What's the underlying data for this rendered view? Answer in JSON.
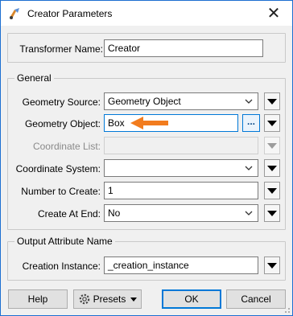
{
  "window": {
    "title": "Creator Parameters",
    "close_glyph": "✕"
  },
  "transformer_name": {
    "label": "Transformer Name:",
    "value": "Creator"
  },
  "general": {
    "label": "General",
    "geometry_source": {
      "label": "Geometry Source:",
      "value": "Geometry Object"
    },
    "geometry_object": {
      "label": "Geometry Object:",
      "value": "Box",
      "browse_label": "..."
    },
    "coordinate_list": {
      "label": "Coordinate List:",
      "value": ""
    },
    "coordinate_system": {
      "label": "Coordinate System:",
      "value": ""
    },
    "number_to_create": {
      "label": "Number to Create:",
      "value": "1"
    },
    "create_at_end": {
      "label": "Create At End:",
      "value": "No"
    }
  },
  "output": {
    "label": "Output Attribute Name",
    "creation_instance": {
      "label": "Creation Instance:",
      "value": "_creation_instance"
    }
  },
  "buttons": {
    "help": "Help",
    "presets": "Presets",
    "ok": "OK",
    "cancel": "Cancel"
  },
  "icons": {
    "app": "fme-transformer-icon",
    "dropdown": "chevron-down-icon",
    "menu": "triangle-down-icon",
    "annotation": "orange-arrow-icon"
  },
  "colors": {
    "accent": "#0078d7",
    "arrow": "#f27c1e"
  }
}
